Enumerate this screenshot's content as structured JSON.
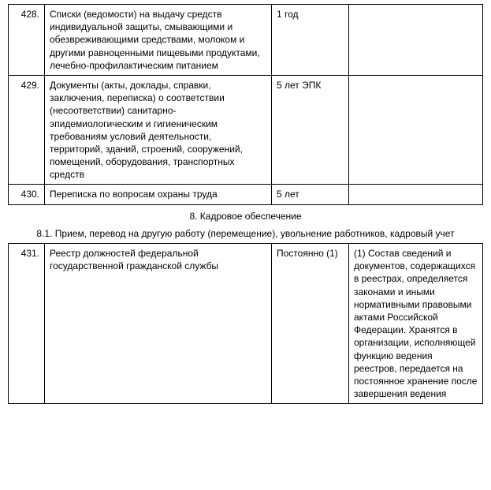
{
  "rows_top": [
    {
      "num": "428.",
      "desc": "Списки (ведомости) на выдачу средств индивидуальной защиты, смывающими и обезвреживающими средствами, молоком и другими равноценными пищевыми продуктами, лечебно-профилактическим питанием",
      "term": "1 год",
      "note": ""
    },
    {
      "num": "429.",
      "desc": "Документы (акты, доклады, справки, заключения, переписка) о соответствии (несоответствии) санитарно-эпидемиологическим и гигиеническим требованиям условий деятельности, территорий, зданий, строений, сооружений, помещений, оборудования, транспортных средств",
      "term": "5 лет ЭПК",
      "note": ""
    },
    {
      "num": "430.",
      "desc": "Переписка по вопросам охраны труда",
      "term": "5 лет",
      "note": ""
    }
  ],
  "section": "8. Кадровое обеспечение",
  "subsection": "8.1. Прием, перевод на другую работу (перемещение), увольнение работников, кадровый учет",
  "rows_bottom": [
    {
      "num": "431.",
      "desc": "Реестр должностей федеральной государственной гражданской службы",
      "term": "Постоянно (1)",
      "note": "(1) Состав сведений и документов, содержащихся в реестрах, определяется законами и иными нормативными правовыми актами Российской Федерации. Хранятся в организации, исполняющей функцию ведения реестров, передается на постоянное хранение после завершения ведения"
    }
  ]
}
